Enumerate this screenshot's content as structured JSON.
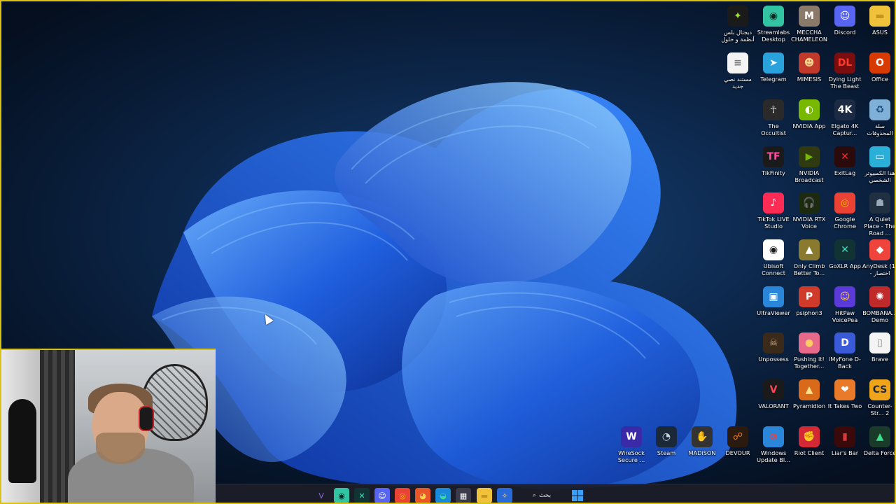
{
  "desktop": {
    "accent_border": "#d8c21a",
    "icons": [
      {
        "label": "ديجتال بلس أنظمة و حلول",
        "glyph": "✦",
        "bg": "#1a1a1a",
        "fg": "#9be22a",
        "icon": "digital-plus-icon"
      },
      {
        "label": "Streamlabs Desktop",
        "glyph": "◉",
        "bg": "#31c3a2",
        "fg": "#0c2a22",
        "icon": "streamlabs-icon"
      },
      {
        "label": "MECCHA CHAMELEON",
        "glyph": "M",
        "bg": "#8b7a6a",
        "fg": "#fff",
        "icon": "meccha-chameleon-icon"
      },
      {
        "label": "Discord",
        "glyph": "☺",
        "bg": "#5865f2",
        "fg": "#fff",
        "icon": "discord-icon"
      },
      {
        "label": "ASUS",
        "glyph": "▬",
        "bg": "#f0c23b",
        "fg": "#c79420",
        "icon": "folder-icon"
      },
      {
        "label": "مستند نصي جديد",
        "glyph": "≡",
        "bg": "#f4f4f4",
        "fg": "#777",
        "icon": "text-document-icon"
      },
      {
        "label": "Telegram",
        "glyph": "➤",
        "bg": "#2aa3dd",
        "fg": "#fff",
        "icon": "telegram-icon"
      },
      {
        "label": "MIMESIS",
        "glyph": "☻",
        "bg": "#c0392b",
        "fg": "#f5d08a",
        "icon": "mimesis-icon"
      },
      {
        "label": "Dying Light The Beast",
        "glyph": "DL",
        "bg": "#7a0d0d",
        "fg": "#ff3b2f",
        "icon": "dying-light-icon"
      },
      {
        "label": "Office",
        "glyph": "O",
        "bg": "#d83b01",
        "fg": "#fff",
        "icon": "office-icon"
      },
      {
        "label": "The Occultist",
        "glyph": "☥",
        "bg": "#2a2a2a",
        "fg": "#ddd",
        "icon": "occultist-icon"
      },
      {
        "label": "NVIDIA App",
        "glyph": "◐",
        "bg": "#76b900",
        "fg": "#fff",
        "icon": "nvidia-icon"
      },
      {
        "label": "Elgato 4K Captur...",
        "glyph": "4K",
        "bg": "#1d2a44",
        "fg": "#fff",
        "icon": "elgato-icon"
      },
      {
        "label": "سلة المحذوفات",
        "glyph": "♻",
        "bg": "#7fb0d8",
        "fg": "#1a4c7a",
        "icon": "recycle-bin-icon"
      },
      {
        "label": "TikFinity",
        "glyph": "TF",
        "bg": "#1a1a1a",
        "fg": "#ff4fa0",
        "icon": "tikfinity-icon"
      },
      {
        "label": "NVIDIA Broadcast",
        "glyph": "▶",
        "bg": "#2f3a10",
        "fg": "#76b900",
        "icon": "nvidia-broadcast-icon"
      },
      {
        "label": "ExitLag",
        "glyph": "✕",
        "bg": "#2a0a0a",
        "fg": "#ff2a2a",
        "icon": "exitlag-icon"
      },
      {
        "label": "هذا الكمبيوتر الشخصي",
        "glyph": "▭",
        "bg": "#2ab0d8",
        "fg": "#e0faff",
        "icon": "this-pc-icon"
      },
      {
        "label": "TikTok LIVE Studio",
        "glyph": "♪",
        "bg": "#fe2c55",
        "fg": "#fff",
        "icon": "tiktok-icon"
      },
      {
        "label": "NVIDIA RTX Voice",
        "glyph": "🎧",
        "bg": "#1c2a10",
        "fg": "#76b900",
        "icon": "rtx-voice-icon"
      },
      {
        "label": "Google Chrome",
        "glyph": "◎",
        "bg": "#ea4335",
        "fg": "#fbbc04",
        "icon": "chrome-icon"
      },
      {
        "label": "A Quiet Place - The Road ...",
        "glyph": "☗",
        "bg": "#203040",
        "fg": "#9ab",
        "icon": "quiet-place-icon"
      },
      {
        "label": "Ubisoft Connect",
        "glyph": "◉",
        "bg": "#ffffff",
        "fg": "#1a1a1a",
        "icon": "ubisoft-icon"
      },
      {
        "label": "Only Climb Better To...",
        "glyph": "▲",
        "bg": "#8a7a30",
        "fg": "#fff",
        "icon": "only-climb-icon"
      },
      {
        "label": "GoXLR App",
        "glyph": "✕",
        "bg": "#113333",
        "fg": "#3ee0c0",
        "icon": "goxlr-icon"
      },
      {
        "label": "AnyDesk (1) - اختصار",
        "glyph": "◆",
        "bg": "#ef443b",
        "fg": "#fff",
        "icon": "anydesk-icon"
      },
      {
        "label": "UltraViewer",
        "glyph": "▣",
        "bg": "#2a86d8",
        "fg": "#fff",
        "icon": "ultraviewer-icon"
      },
      {
        "label": "psiphon3",
        "glyph": "P",
        "bg": "#d03a2a",
        "fg": "#fff",
        "icon": "psiphon-icon"
      },
      {
        "label": "HitPaw VoicePea",
        "glyph": "☺",
        "bg": "#5a3ad8",
        "fg": "#ffd34d",
        "icon": "hitpaw-icon"
      },
      {
        "label": "BOMBANA... Demo",
        "glyph": "✺",
        "bg": "#c02a2a",
        "fg": "#fff",
        "icon": "bombana-icon"
      },
      {
        "label": "Unpossess",
        "glyph": "☠",
        "bg": "#3a2a1a",
        "fg": "#c8a080",
        "icon": "unpossess-icon"
      },
      {
        "label": "Pushing it! Together...",
        "glyph": "●",
        "bg": "#e86a8a",
        "fg": "#ffcc66",
        "icon": "pushing-it-icon"
      },
      {
        "label": "iMyFone D-Back",
        "glyph": "D",
        "bg": "#3a5ad8",
        "fg": "#fff",
        "icon": "imyfone-icon"
      },
      {
        "label": "Brave",
        "glyph": "▯",
        "bg": "#f4f4f4",
        "fg": "#888",
        "icon": "brave-file-icon"
      },
      {
        "label": "VALORANT",
        "glyph": "V",
        "bg": "#1a1a1a",
        "fg": "#ff4655",
        "icon": "valorant-icon"
      },
      {
        "label": "Pyramidion",
        "glyph": "▲",
        "bg": "#d86a1a",
        "fg": "#ffe08a",
        "icon": "pyramidion-icon"
      },
      {
        "label": "It Takes Two",
        "glyph": "❤",
        "bg": "#e87a2a",
        "fg": "#fff",
        "icon": "it-takes-two-icon"
      },
      {
        "label": "Counter-Str... 2",
        "glyph": "CS",
        "bg": "#f0a41a",
        "fg": "#1a2a44",
        "icon": "counter-strike-icon"
      },
      {
        "label": "WireSock Secure ...",
        "glyph": "W",
        "bg": "#3a2aa8",
        "fg": "#fff",
        "icon": "wiresock-icon"
      },
      {
        "label": "Steam",
        "glyph": "◔",
        "bg": "#1b2838",
        "fg": "#c7d5e0",
        "icon": "steam-icon"
      },
      {
        "label": "MADiSON",
        "glyph": "✋",
        "bg": "#333",
        "fg": "#ddd",
        "icon": "madison-icon"
      },
      {
        "label": "DEVOUR",
        "glyph": "☍",
        "bg": "#2a1a10",
        "fg": "#e87a2a",
        "icon": "devour-icon"
      },
      {
        "label": "Windows Update Bl...",
        "glyph": "⊘",
        "bg": "#2a86d8",
        "fg": "#ff3a3a",
        "icon": "windows-update-blocker-icon"
      },
      {
        "label": "Riot Client",
        "glyph": "✊",
        "bg": "#d32936",
        "fg": "#fff",
        "icon": "riot-client-icon"
      },
      {
        "label": "Liar's Bar",
        "glyph": "▮",
        "bg": "#3a0a0a",
        "fg": "#d83a3a",
        "icon": "liars-bar-icon"
      },
      {
        "label": "Delta Force",
        "glyph": "▲",
        "bg": "#1a3a2a",
        "fg": "#3ae08a",
        "icon": "delta-force-icon"
      }
    ]
  },
  "taskbar": {
    "search_label": "بحث",
    "items": [
      {
        "icon": "vs-code-icon",
        "glyph": "V",
        "bg": "transparent",
        "fg": "#8a6ad8"
      },
      {
        "icon": "streamlabs-taskbar-icon",
        "glyph": "◉",
        "bg": "#31c3a2",
        "fg": "#0c2a22"
      },
      {
        "icon": "goxlr-taskbar-icon",
        "glyph": "✕",
        "bg": "#113333",
        "fg": "#3ee0c0"
      },
      {
        "icon": "discord-taskbar-icon",
        "glyph": "☺",
        "bg": "#5865f2",
        "fg": "#fff"
      },
      {
        "icon": "chrome-taskbar-icon",
        "glyph": "◎",
        "bg": "#ea4335",
        "fg": "#fbbc04"
      },
      {
        "icon": "firefox-taskbar-icon",
        "glyph": "◕",
        "bg": "#e8562a",
        "fg": "#ffd34d"
      },
      {
        "icon": "edge-taskbar-icon",
        "glyph": "◒",
        "bg": "#1a8ad8",
        "fg": "#3ae08a"
      },
      {
        "icon": "store-taskbar-icon",
        "glyph": "▦",
        "bg": "#3a3a4a",
        "fg": "#fff"
      },
      {
        "icon": "file-explorer-taskbar-icon",
        "glyph": "▬",
        "bg": "#f0c23b",
        "fg": "#c79420"
      },
      {
        "icon": "copilot-taskbar-icon",
        "glyph": "✧",
        "bg": "#2a6ad8",
        "fg": "#ffd34d"
      }
    ]
  }
}
